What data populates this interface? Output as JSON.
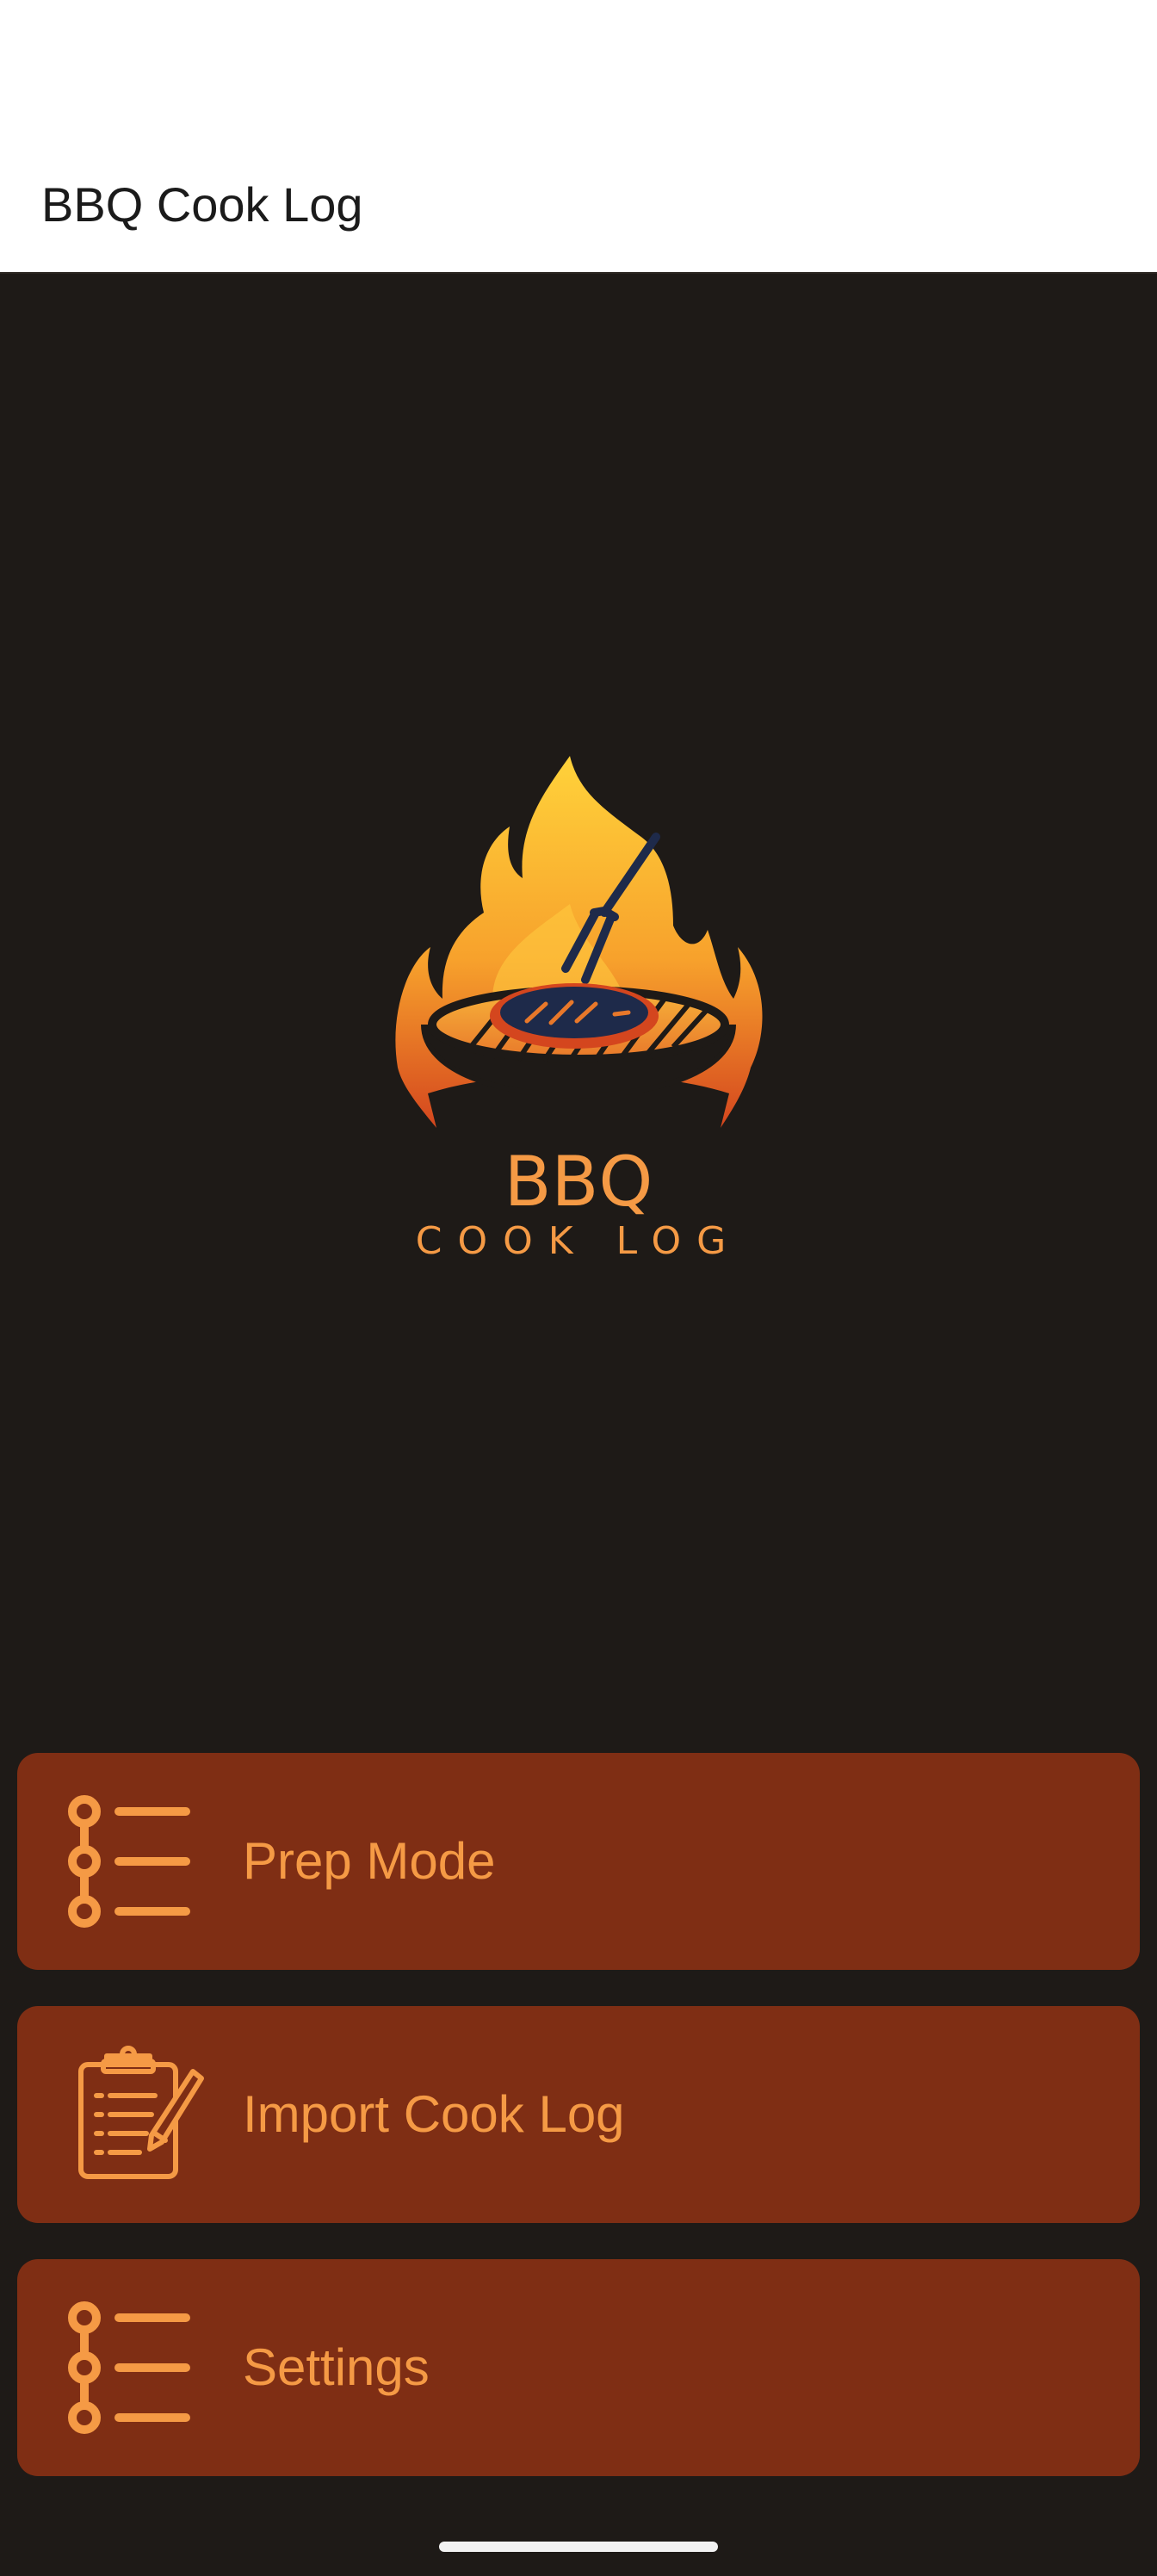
{
  "app_bar": {
    "title": "BBQ Cook Log"
  },
  "logo": {
    "lines": [
      "BBQ",
      "COOK LOG"
    ],
    "icon": "flame-grill-logo"
  },
  "menu": [
    {
      "label": "Prep Mode",
      "icon": "list-bullets-icon"
    },
    {
      "label": "Import Cook Log",
      "icon": "clipboard-pencil-icon"
    },
    {
      "label": "Settings",
      "icon": "list-bullets-icon"
    }
  ],
  "colors": {
    "background": "#1e1a17",
    "app_bar": "#ffffff",
    "button": "#7f2e14",
    "accent": "#f59a45"
  }
}
